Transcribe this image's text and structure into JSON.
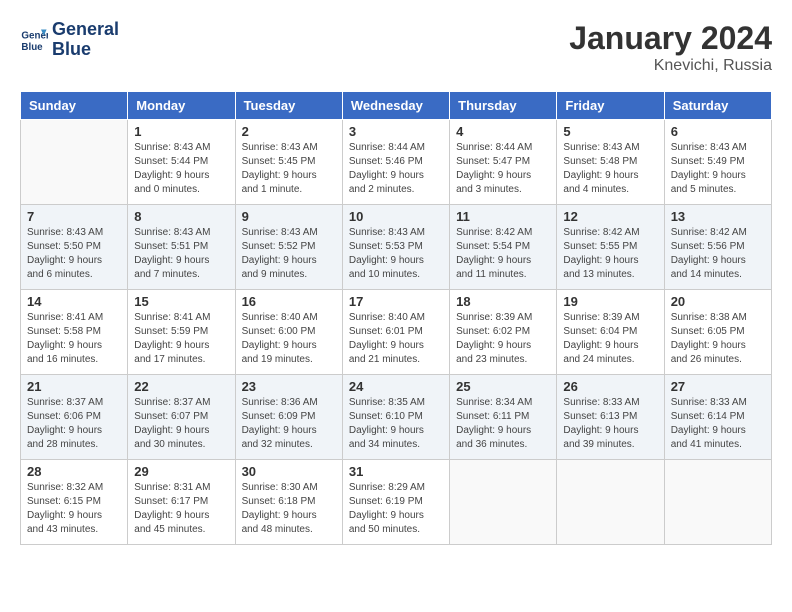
{
  "header": {
    "logo_line1": "General",
    "logo_line2": "Blue",
    "month_title": "January 2024",
    "location": "Knevichi, Russia"
  },
  "days_of_week": [
    "Sunday",
    "Monday",
    "Tuesday",
    "Wednesday",
    "Thursday",
    "Friday",
    "Saturday"
  ],
  "weeks": [
    [
      {
        "day": "",
        "info": ""
      },
      {
        "day": "1",
        "info": "Sunrise: 8:43 AM\nSunset: 5:44 PM\nDaylight: 9 hours\nand 0 minutes."
      },
      {
        "day": "2",
        "info": "Sunrise: 8:43 AM\nSunset: 5:45 PM\nDaylight: 9 hours\nand 1 minute."
      },
      {
        "day": "3",
        "info": "Sunrise: 8:44 AM\nSunset: 5:46 PM\nDaylight: 9 hours\nand 2 minutes."
      },
      {
        "day": "4",
        "info": "Sunrise: 8:44 AM\nSunset: 5:47 PM\nDaylight: 9 hours\nand 3 minutes."
      },
      {
        "day": "5",
        "info": "Sunrise: 8:43 AM\nSunset: 5:48 PM\nDaylight: 9 hours\nand 4 minutes."
      },
      {
        "day": "6",
        "info": "Sunrise: 8:43 AM\nSunset: 5:49 PM\nDaylight: 9 hours\nand 5 minutes."
      }
    ],
    [
      {
        "day": "7",
        "info": "Sunrise: 8:43 AM\nSunset: 5:50 PM\nDaylight: 9 hours\nand 6 minutes."
      },
      {
        "day": "8",
        "info": "Sunrise: 8:43 AM\nSunset: 5:51 PM\nDaylight: 9 hours\nand 7 minutes."
      },
      {
        "day": "9",
        "info": "Sunrise: 8:43 AM\nSunset: 5:52 PM\nDaylight: 9 hours\nand 9 minutes."
      },
      {
        "day": "10",
        "info": "Sunrise: 8:43 AM\nSunset: 5:53 PM\nDaylight: 9 hours\nand 10 minutes."
      },
      {
        "day": "11",
        "info": "Sunrise: 8:42 AM\nSunset: 5:54 PM\nDaylight: 9 hours\nand 11 minutes."
      },
      {
        "day": "12",
        "info": "Sunrise: 8:42 AM\nSunset: 5:55 PM\nDaylight: 9 hours\nand 13 minutes."
      },
      {
        "day": "13",
        "info": "Sunrise: 8:42 AM\nSunset: 5:56 PM\nDaylight: 9 hours\nand 14 minutes."
      }
    ],
    [
      {
        "day": "14",
        "info": "Sunrise: 8:41 AM\nSunset: 5:58 PM\nDaylight: 9 hours\nand 16 minutes."
      },
      {
        "day": "15",
        "info": "Sunrise: 8:41 AM\nSunset: 5:59 PM\nDaylight: 9 hours\nand 17 minutes."
      },
      {
        "day": "16",
        "info": "Sunrise: 8:40 AM\nSunset: 6:00 PM\nDaylight: 9 hours\nand 19 minutes."
      },
      {
        "day": "17",
        "info": "Sunrise: 8:40 AM\nSunset: 6:01 PM\nDaylight: 9 hours\nand 21 minutes."
      },
      {
        "day": "18",
        "info": "Sunrise: 8:39 AM\nSunset: 6:02 PM\nDaylight: 9 hours\nand 23 minutes."
      },
      {
        "day": "19",
        "info": "Sunrise: 8:39 AM\nSunset: 6:04 PM\nDaylight: 9 hours\nand 24 minutes."
      },
      {
        "day": "20",
        "info": "Sunrise: 8:38 AM\nSunset: 6:05 PM\nDaylight: 9 hours\nand 26 minutes."
      }
    ],
    [
      {
        "day": "21",
        "info": "Sunrise: 8:37 AM\nSunset: 6:06 PM\nDaylight: 9 hours\nand 28 minutes."
      },
      {
        "day": "22",
        "info": "Sunrise: 8:37 AM\nSunset: 6:07 PM\nDaylight: 9 hours\nand 30 minutes."
      },
      {
        "day": "23",
        "info": "Sunrise: 8:36 AM\nSunset: 6:09 PM\nDaylight: 9 hours\nand 32 minutes."
      },
      {
        "day": "24",
        "info": "Sunrise: 8:35 AM\nSunset: 6:10 PM\nDaylight: 9 hours\nand 34 minutes."
      },
      {
        "day": "25",
        "info": "Sunrise: 8:34 AM\nSunset: 6:11 PM\nDaylight: 9 hours\nand 36 minutes."
      },
      {
        "day": "26",
        "info": "Sunrise: 8:33 AM\nSunset: 6:13 PM\nDaylight: 9 hours\nand 39 minutes."
      },
      {
        "day": "27",
        "info": "Sunrise: 8:33 AM\nSunset: 6:14 PM\nDaylight: 9 hours\nand 41 minutes."
      }
    ],
    [
      {
        "day": "28",
        "info": "Sunrise: 8:32 AM\nSunset: 6:15 PM\nDaylight: 9 hours\nand 43 minutes."
      },
      {
        "day": "29",
        "info": "Sunrise: 8:31 AM\nSunset: 6:17 PM\nDaylight: 9 hours\nand 45 minutes."
      },
      {
        "day": "30",
        "info": "Sunrise: 8:30 AM\nSunset: 6:18 PM\nDaylight: 9 hours\nand 48 minutes."
      },
      {
        "day": "31",
        "info": "Sunrise: 8:29 AM\nSunset: 6:19 PM\nDaylight: 9 hours\nand 50 minutes."
      },
      {
        "day": "",
        "info": ""
      },
      {
        "day": "",
        "info": ""
      },
      {
        "day": "",
        "info": ""
      }
    ]
  ]
}
